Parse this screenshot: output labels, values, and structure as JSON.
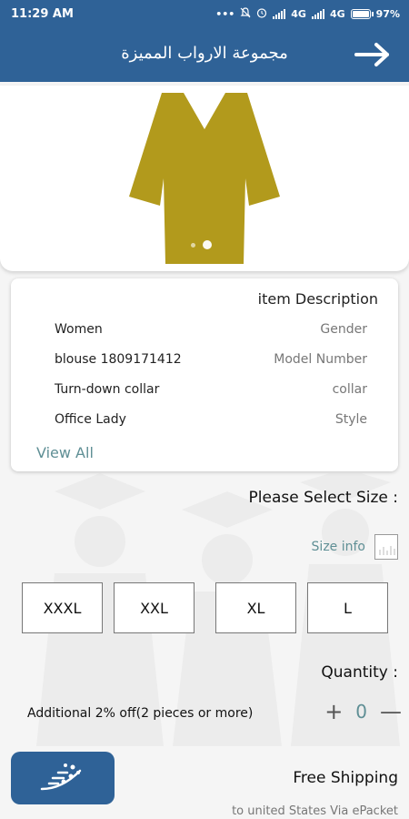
{
  "status_bar": {
    "time": "11:29 AM",
    "network_1": "4G",
    "network_2": "4G",
    "battery": "97%",
    "icons": [
      "dots-icon",
      "mute-icon",
      "alarm-icon",
      "signal-icon",
      "signal-icon",
      "battery-icon"
    ]
  },
  "app_bar": {
    "title": "مجموعة الارواب المميزة",
    "back_icon": "arrow-right-icon"
  },
  "carousel": {
    "image": "gown-icon",
    "image_color": "#b29a1c",
    "pages": 2,
    "active_page": 2
  },
  "description": {
    "title": "item Description",
    "rows": [
      {
        "value": "Women",
        "label": "Gender"
      },
      {
        "value": "blouse 1809171412",
        "label": "Model Number"
      },
      {
        "value": "Turn-down collar",
        "label": "collar"
      },
      {
        "value": "Office Lady",
        "label": "Style"
      }
    ],
    "view_all": "View All"
  },
  "size": {
    "title": "Please Select Size :",
    "info_label": "Size info",
    "options": [
      "XXXL",
      "XXL",
      "XL",
      "L"
    ]
  },
  "quantity": {
    "title": "Quantity :",
    "discount_note": "Additional 2% off(2 pieces or more)",
    "plus": "+",
    "value": "0",
    "minus": "—"
  },
  "shipping": {
    "title": "Free Shipping",
    "subtitle": "to united States Via ePacket",
    "button_icon": "fast-delivery-icon"
  },
  "colors": {
    "primary": "#2f6297",
    "accent_teal": "#5f8f95",
    "gown": "#b29a1c"
  }
}
